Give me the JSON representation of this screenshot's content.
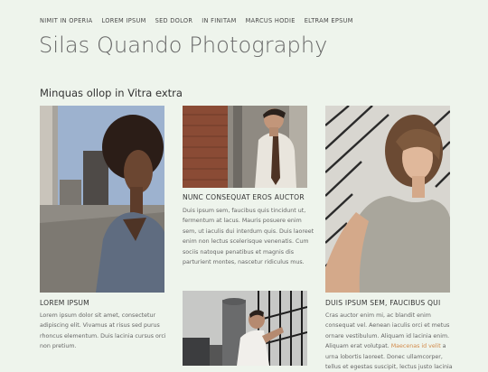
{
  "nav": {
    "items": [
      "NIMIT IN OPERIA",
      "LOREM IPSUM",
      "SED DOLOR",
      "IN FINITAM",
      "MARCUS HODIE",
      "ELTRAM EPSUM"
    ]
  },
  "site": {
    "title": "Silas Quando Photography"
  },
  "section": {
    "title": "Minquas ollop in Vitra extra"
  },
  "cards": [
    {
      "title": "LOREM IPSUM",
      "lines": [
        "Lorem ipsum dolor sit amet, consectetur",
        "adipiscing elit. Vivamus at risus sed purus",
        "rhoncus elementum. Duis lacinia cursus orci",
        "non pretium."
      ]
    },
    {
      "title": "NUNC CONSEQUAT EROS AUCTOR",
      "lines": [
        "Duis ipsum sem, faucibus quis tincidunt ut,",
        "fermentum at lacus. Mauris posuere enim",
        "sem, ut iaculis dui interdum quis. Duis laoreet",
        "enim non lectus scelerisque venenatis. Cum",
        "sociis natoque penatibus et magnis dis",
        "parturient montes, nascetur ridiculus mus."
      ]
    },
    {
      "title": "DUIS IPSUM SEM, FAUCIBUS QUI",
      "lines": [
        "Cras auctor enim mi, ac blandit enim",
        "consequat vel. Aenean iaculis orci et metus",
        "ornare vestibulum. Aliquam id lacinia enim.",
        "Aliquam erat volutpat.",
        "urna lobortis laoreet. Donec ullamcorper,",
        "tellus et egestas suscipit, lectus justo lacinia"
      ],
      "link_text": "Maecenas id velit",
      "link_suffix": " a"
    }
  ],
  "colors": {
    "background": "#eef4ec",
    "link": "#d28a4a"
  }
}
